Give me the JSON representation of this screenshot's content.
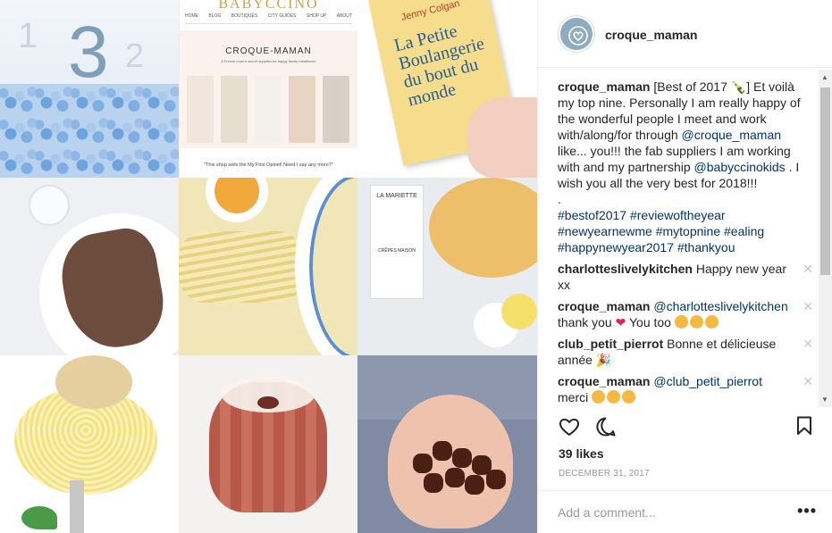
{
  "grid": {
    "tile1": {
      "big_number": "3",
      "left_number": "1",
      "right_number": "2"
    },
    "tile2": {
      "logo": "BABYCCINO",
      "nav": [
        "HOME",
        "BLOG",
        "BOUTIQUES",
        "CITY GUIDES",
        "SHOP UP",
        "ABOUT"
      ],
      "title": "CROQUE-MAMAN",
      "subtitle": "A French mum's secret supplies for happy family mealtimes!",
      "quote": "\"This shop sells the My First Opinel! Need I say any more?\""
    },
    "tile3": {
      "author": "Jenny Colgan",
      "title": "La Petite Boulangerie du bout du monde"
    },
    "tile6": {
      "box_label": "LA MARIETTE",
      "box_sub": "CRÊPES MAISON"
    }
  },
  "post": {
    "username": "croque_maman",
    "caption_user": "croque_maman",
    "caption_text_1": "[Best of 2017 🍾] Et voilà my top nine. Personally I am really happy of the wonderful people I meet and work with/along/for through ",
    "caption_mention_1": "@croque_maman",
    "caption_text_2": " like... you!!! the fab suppliers I am working with and my partnership ",
    "caption_mention_2": "@babyccinokids",
    "caption_text_3": " . I wish you all the very best for 2018!!!",
    "caption_dot": ".",
    "hashtags": "#bestof2017 #reviewoftheyear #newyearnewme #mytopnine #ealing #happynewyear2017 #thankyou",
    "comments": [
      {
        "user": "charlotteslivelykitchen",
        "mention": "",
        "text": "Happy new year xx"
      },
      {
        "user": "croque_maman",
        "mention": "@charlotteslivelykitchen",
        "text": "thank you",
        "tail": "You too"
      },
      {
        "user": "club_petit_pierrot",
        "mention": "",
        "text": "Bonne et délicieuse année"
      },
      {
        "user": "croque_maman",
        "mention": "@club_petit_pierrot",
        "text": "merci"
      }
    ],
    "close_glyph": "✕",
    "likes": "39 likes",
    "date": "DECEMBER 31, 2017",
    "comment_placeholder": "Add a comment...",
    "more_glyph": "•••"
  },
  "icons": {
    "like": "heart-outline-icon",
    "comment": "speech-bubble-icon",
    "save": "bookmark-icon"
  }
}
